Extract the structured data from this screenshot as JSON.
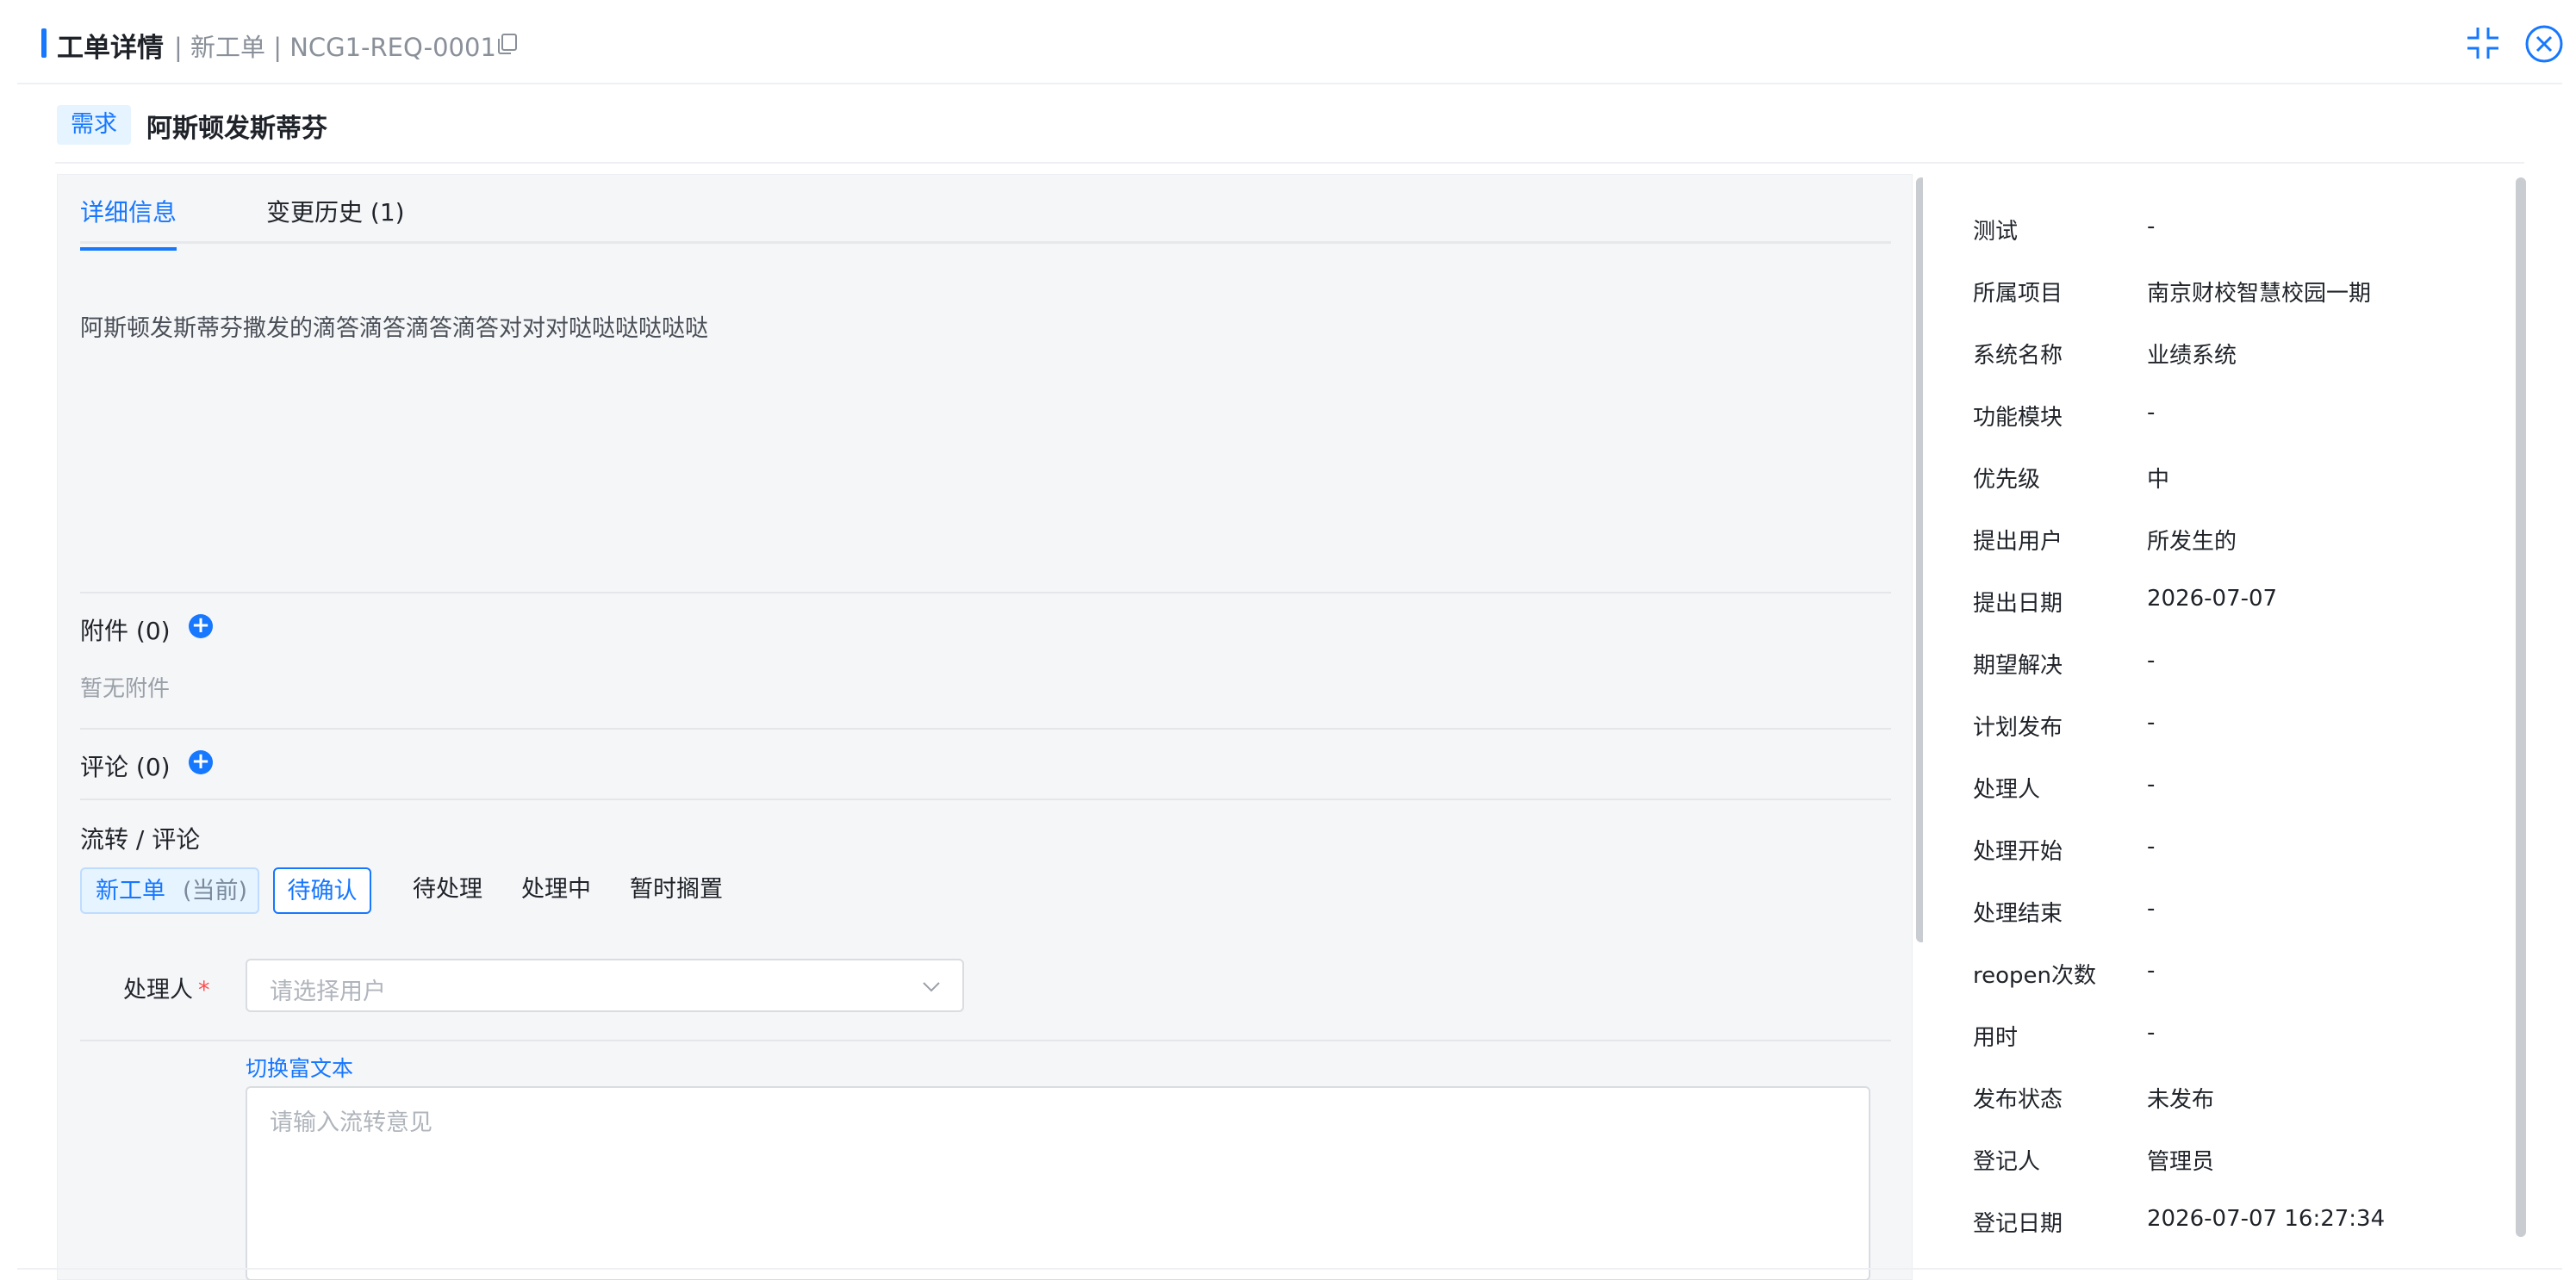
{
  "header": {
    "title": "工单详情",
    "subtitle": "| 新工单 | NCG1-REQ-0001",
    "icons": {
      "copy": "copy-icon",
      "collapse": "collapse-icon",
      "close": "close-icon"
    }
  },
  "issue": {
    "type_tag": "需求",
    "title": "阿斯顿发斯蒂芬"
  },
  "tabs": [
    {
      "label": "详细信息",
      "active": true
    },
    {
      "label": "变更历史 (1)",
      "active": false
    }
  ],
  "description": "阿斯顿发斯蒂芬撒发的滴答滴答滴答滴答对对对哒哒哒哒哒哒",
  "attachments": {
    "title": "附件 (0)",
    "empty": "暂无附件"
  },
  "comments": {
    "title": "评论 (0)"
  },
  "flow": {
    "title": "流转 / 评论",
    "current": {
      "label": "新工单",
      "note": "(当前)"
    },
    "steps": [
      {
        "label": "待确认",
        "selected": true
      },
      {
        "label": "待处理",
        "selected": false
      },
      {
        "label": "处理中",
        "selected": false
      },
      {
        "label": "暂时搁置",
        "selected": false
      }
    ],
    "assignee_label": "处理人",
    "required_mark": "*",
    "assignee_placeholder": "请选择用户",
    "rich_text_link": "切换富文本",
    "opinion_placeholder": "请输入流转意见"
  },
  "info": [
    {
      "label": "测试",
      "value": "-"
    },
    {
      "label": "所属项目",
      "value": "南京财校智慧校园一期"
    },
    {
      "label": "系统名称",
      "value": "业绩系统"
    },
    {
      "label": "功能模块",
      "value": "-"
    },
    {
      "label": "优先级",
      "value": "中"
    },
    {
      "label": "提出用户",
      "value": "所发生的"
    },
    {
      "label": "提出日期",
      "value": "2026-07-07"
    },
    {
      "label": "期望解决",
      "value": "-"
    },
    {
      "label": "计划发布",
      "value": "-"
    },
    {
      "label": "处理人",
      "value": "-"
    },
    {
      "label": "处理开始",
      "value": "-"
    },
    {
      "label": "处理结束",
      "value": "-"
    },
    {
      "label": "reopen次数",
      "value": "-"
    },
    {
      "label": "用时",
      "value": "-"
    },
    {
      "label": "发布状态",
      "value": "未发布"
    },
    {
      "label": "登记人",
      "value": "管理员"
    },
    {
      "label": "登记日期",
      "value": "2026-07-07 16:27:34"
    }
  ],
  "colors": {
    "accent": "#1677ff",
    "tag_bg": "#e6f4ff",
    "panel_bg": "#f5f6f8",
    "required": "#ff4d4f"
  }
}
